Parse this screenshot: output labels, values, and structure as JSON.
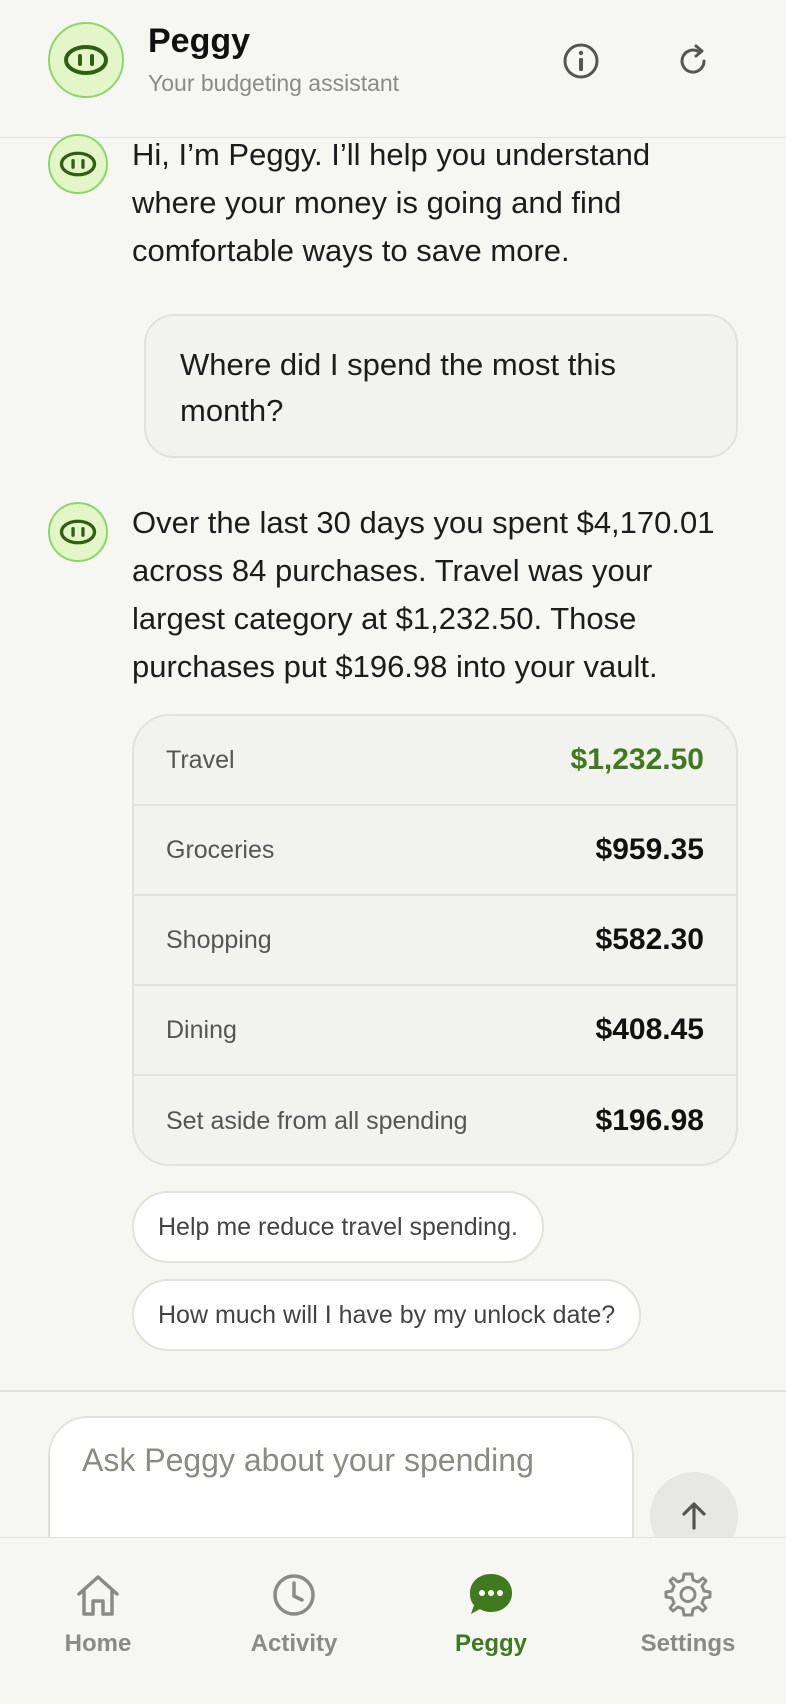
{
  "header": {
    "title": "Peggy",
    "subtitle": "Your budgeting assistant",
    "avatar_icon": "pig-snout-icon",
    "info_icon": "info-icon",
    "refresh_icon": "refresh-icon"
  },
  "messages": {
    "intro": "Hi, I’m Peggy. I’ll help you understand where your money is going and find comfortable ways to save more.",
    "user_question": "Where did I spend the most this month?",
    "answer": "Over the last 30 days you spent $4,170.01 across 84 purchases. Travel was your largest category at $1,232.50. Those purchases put $196.98 into your vault."
  },
  "breakdown": {
    "rows": [
      {
        "label": "Travel",
        "value": "$1,232.50",
        "highlight": true
      },
      {
        "label": "Groceries",
        "value": "$959.35"
      },
      {
        "label": "Shopping",
        "value": "$582.30"
      },
      {
        "label": "Dining",
        "value": "$408.45"
      },
      {
        "label": "Set aside from all spending",
        "value": "$196.98"
      }
    ]
  },
  "suggestions": [
    "Help me reduce travel spending.",
    "How much will I have by my unlock date?"
  ],
  "composer": {
    "placeholder": "Ask Peggy about your spending",
    "send_icon": "arrow-up-icon"
  },
  "nav": {
    "items": [
      {
        "label": "Home",
        "icon": "home-icon"
      },
      {
        "label": "Activity",
        "icon": "clock-icon"
      },
      {
        "label": "Peggy",
        "icon": "chat-bubble-icon",
        "active": true
      },
      {
        "label": "Settings",
        "icon": "gear-icon"
      }
    ]
  },
  "colors": {
    "accent": "#3f7a1f",
    "avatar_bg": "#e3f6c8",
    "avatar_border": "#8fd66a",
    "background": "#f6f6f2"
  }
}
